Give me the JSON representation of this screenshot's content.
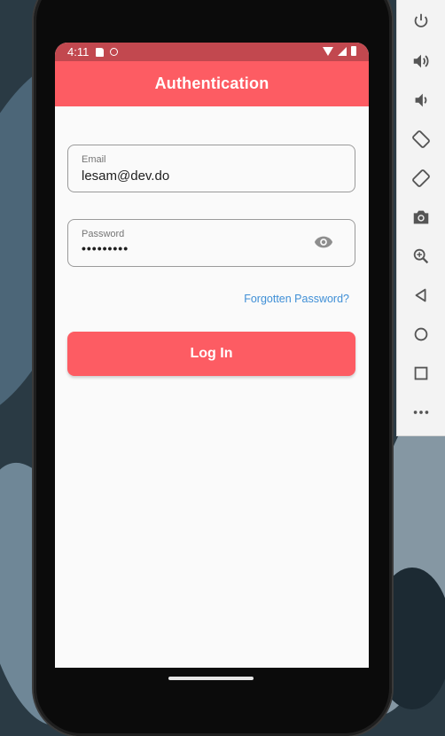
{
  "status_bar": {
    "time": "4:11"
  },
  "app_bar": {
    "title": "Authentication"
  },
  "login_form": {
    "email": {
      "label": "Email",
      "value": "lesam@dev.do"
    },
    "password": {
      "label": "Password",
      "value": "•••••••••"
    },
    "forgot_password": "Forgotten Password?",
    "login_button": "Log In"
  },
  "colors": {
    "primary": "#fd5c63",
    "status_bar": "#c2484f",
    "link": "#3f8fd6",
    "background": "#fafafa"
  },
  "emulator_toolbar": {
    "icons": [
      "power-icon",
      "volume-up-icon",
      "volume-down-icon",
      "rotate-left-icon",
      "rotate-right-icon",
      "camera-icon",
      "zoom-icon",
      "back-icon",
      "home-icon",
      "overview-icon",
      "more-icon"
    ]
  }
}
